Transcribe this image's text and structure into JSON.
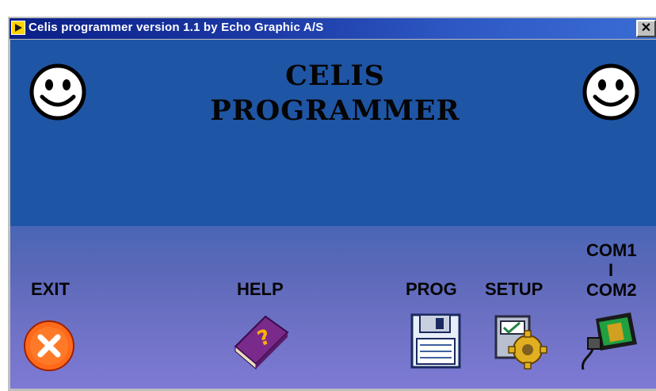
{
  "window": {
    "title": "Celis programmer version 1.1 by Echo Graphic A/S",
    "close_label": "✕"
  },
  "main": {
    "title_line1": "CELIS",
    "title_line2": "PROGRAMMER"
  },
  "buttons": {
    "exit": "EXIT",
    "help": "HELP",
    "prog": "PROG",
    "setup": "SETUP",
    "com_line1": "COM1",
    "com_line2": "I",
    "com_line3": "COM2"
  },
  "icons": [
    "smiley-icon",
    "exit-icon",
    "help-book-icon",
    "floppy-disk-icon",
    "setup-gear-icon",
    "serial-port-icon"
  ],
  "colors": {
    "upper_background": "#1f55a5",
    "lower_background": "#6d71c4",
    "titlebar": "#0a1f86"
  }
}
